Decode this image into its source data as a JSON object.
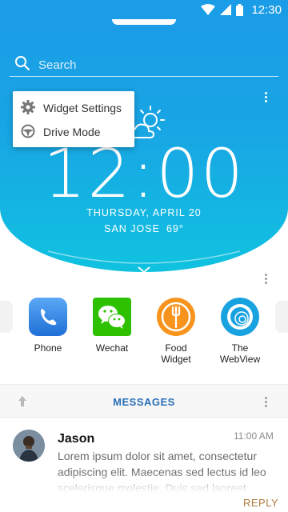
{
  "status_bar": {
    "time": "12:30"
  },
  "search": {
    "placeholder": "Search"
  },
  "popup_menu": {
    "items": [
      {
        "label": "Widget Settings",
        "icon": "gear-icon"
      },
      {
        "label": "Drive Mode",
        "icon": "steering-wheel-icon"
      }
    ]
  },
  "clock": {
    "time": "12:00",
    "date": "THURSDAY, APRIL 20",
    "city": "SAN JOSE",
    "temperature": "69°",
    "weather_icon": "partly-cloudy-icon"
  },
  "apps": [
    {
      "label": "Phone",
      "icon": "phone-icon"
    },
    {
      "label": "Wechat",
      "icon": "wechat-icon"
    },
    {
      "label": "Food\nWidget",
      "icon": "food-widget-icon"
    },
    {
      "label": "The\nWebView",
      "icon": "webview-icon"
    }
  ],
  "messages": {
    "title": "MESSAGES",
    "item": {
      "sender": "Jason",
      "time": "11:00 AM",
      "body": "Lorem ipsum dolor sit amet, consectetur adipiscing elit. Maecenas sed lectus id leo scelerisque molestie. Duis sed laoreet",
      "action": "REPLY"
    }
  },
  "colors": {
    "accent": "#1a9ce6",
    "messages_title": "#2a6fb8",
    "reply": "#b07a3a"
  }
}
